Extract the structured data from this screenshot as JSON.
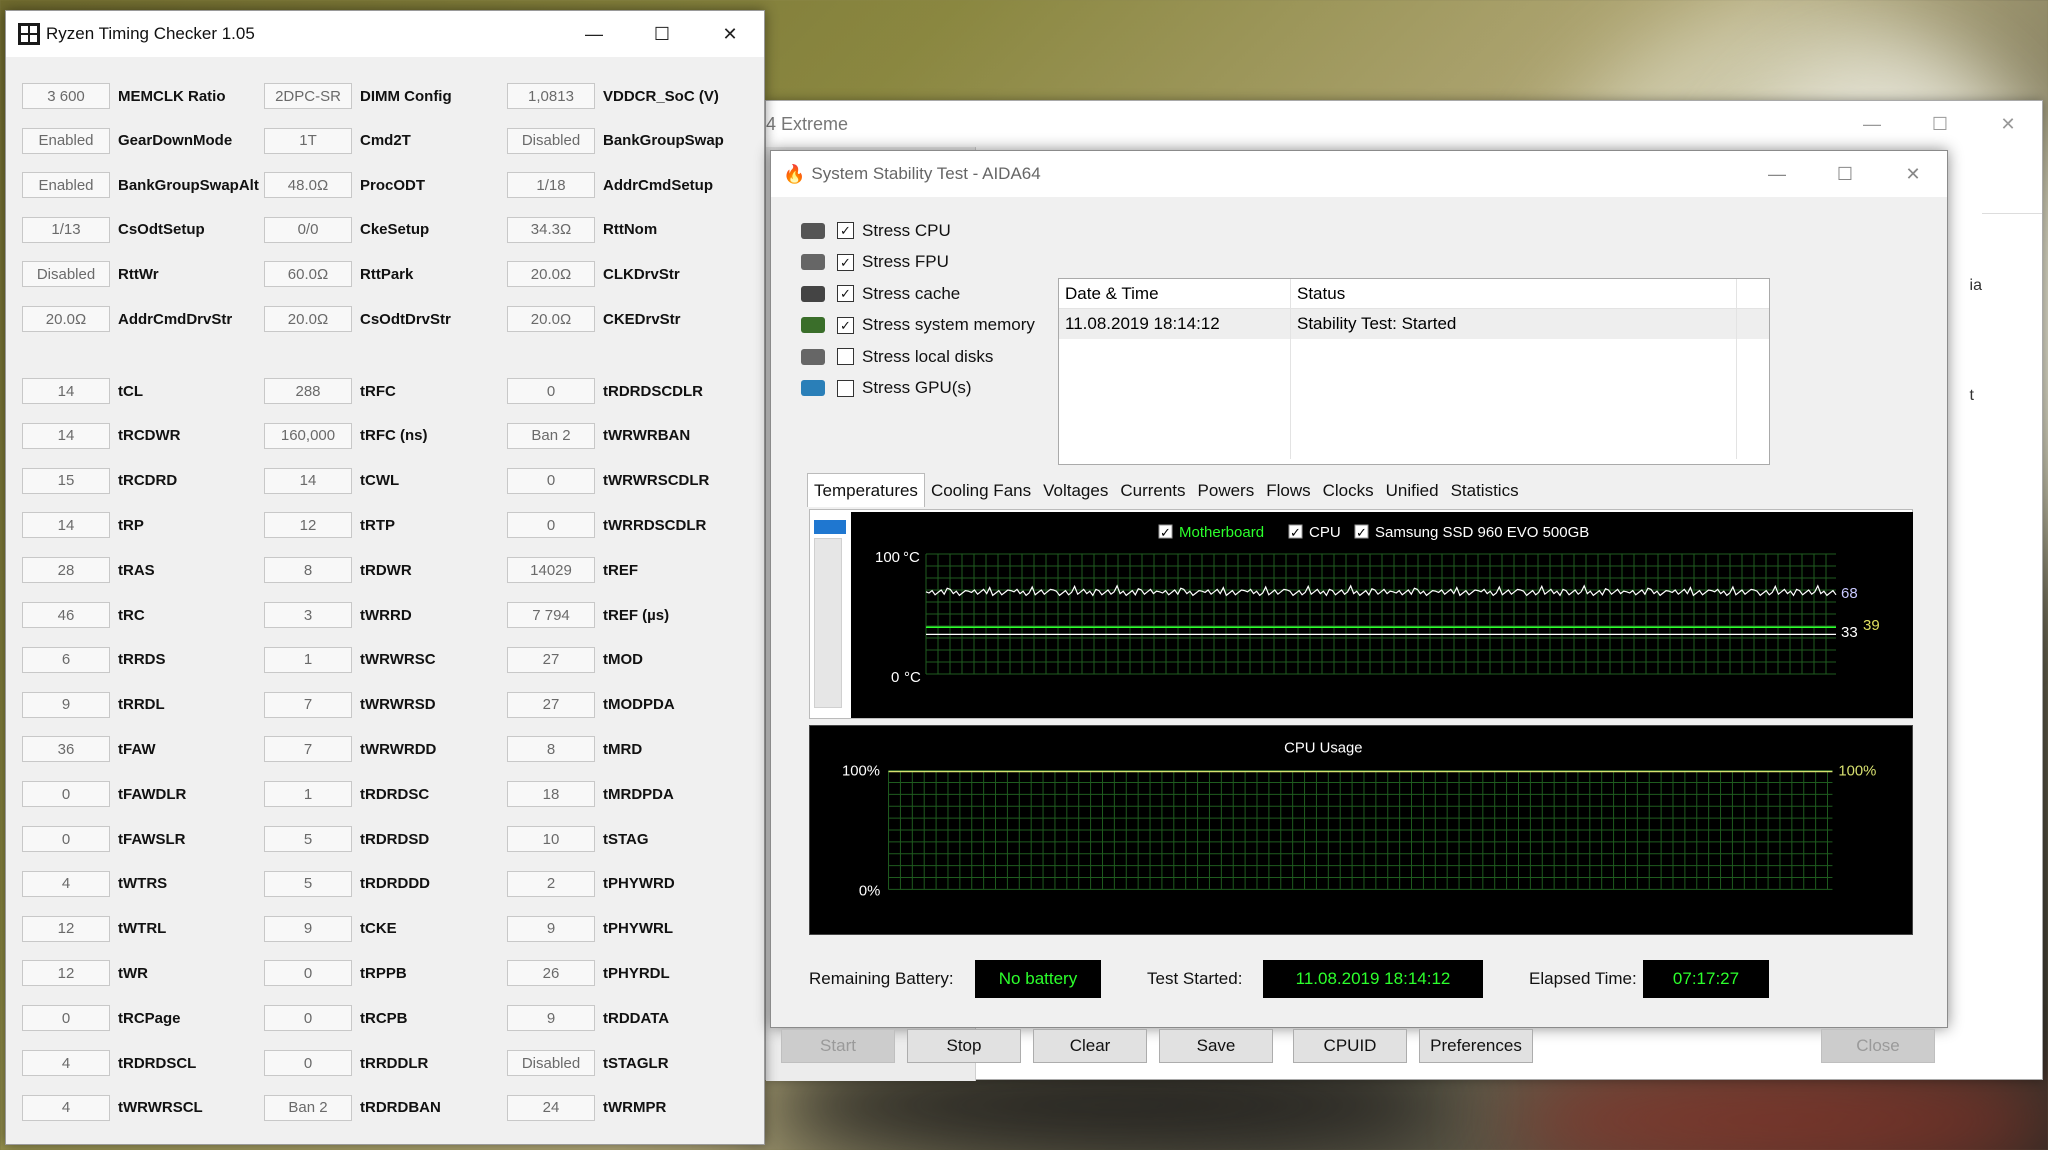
{
  "rtc": {
    "title": "Ryzen Timing Checker 1.05",
    "columns": [
      [
        {
          "val": "3 600",
          "label": "MEMCLK Ratio"
        },
        {
          "val": "Enabled",
          "label": "GearDownMode"
        },
        {
          "val": "Enabled",
          "label": "BankGroupSwapAlt"
        },
        {
          "val": "1/13",
          "label": "CsOdtSetup"
        },
        {
          "val": "Disabled",
          "label": "RttWr"
        },
        {
          "val": "20.0Ω",
          "label": "AddrCmdDrvStr"
        },
        {
          "val": "14",
          "label": "tCL"
        },
        {
          "val": "14",
          "label": "tRCDWR"
        },
        {
          "val": "15",
          "label": "tRCDRD"
        },
        {
          "val": "14",
          "label": "tRP"
        },
        {
          "val": "28",
          "label": "tRAS"
        },
        {
          "val": "46",
          "label": "tRC"
        },
        {
          "val": "6",
          "label": "tRRDS"
        },
        {
          "val": "9",
          "label": "tRRDL"
        },
        {
          "val": "36",
          "label": "tFAW"
        },
        {
          "val": "0",
          "label": "tFAWDLR"
        },
        {
          "val": "0",
          "label": "tFAWSLR"
        },
        {
          "val": "4",
          "label": "tWTRS"
        },
        {
          "val": "12",
          "label": "tWTRL"
        },
        {
          "val": "12",
          "label": "tWR"
        },
        {
          "val": "0",
          "label": "tRCPage"
        },
        {
          "val": "4",
          "label": "tRDRDSCL"
        },
        {
          "val": "4",
          "label": "tWRWRSCL"
        }
      ],
      [
        {
          "val": "2DPC-SR",
          "label": "DIMM Config"
        },
        {
          "val": "1T",
          "label": "Cmd2T"
        },
        {
          "val": "48.0Ω",
          "label": "ProcODT"
        },
        {
          "val": "0/0",
          "label": "CkeSetup"
        },
        {
          "val": "60.0Ω",
          "label": "RttPark"
        },
        {
          "val": "20.0Ω",
          "label": "CsOdtDrvStr"
        },
        {
          "val": "288",
          "label": "tRFC"
        },
        {
          "val": "160,000",
          "label": "tRFC (ns)"
        },
        {
          "val": "14",
          "label": "tCWL"
        },
        {
          "val": "12",
          "label": "tRTP"
        },
        {
          "val": "8",
          "label": "tRDWR"
        },
        {
          "val": "3",
          "label": "tWRRD"
        },
        {
          "val": "1",
          "label": "tWRWRSC"
        },
        {
          "val": "7",
          "label": "tWRWRSD"
        },
        {
          "val": "7",
          "label": "tWRWRDD"
        },
        {
          "val": "1",
          "label": "tRDRDSC"
        },
        {
          "val": "5",
          "label": "tRDRDSD"
        },
        {
          "val": "5",
          "label": "tRDRDDD"
        },
        {
          "val": "9",
          "label": "tCKE"
        },
        {
          "val": "0",
          "label": "tRPPB"
        },
        {
          "val": "0",
          "label": "tRCPB"
        },
        {
          "val": "0",
          "label": "tRRDDLR"
        },
        {
          "val": "Ban 2",
          "label": "tRDRDBAN"
        }
      ],
      [
        {
          "val": "1,0813",
          "label": "VDDCR_SoC (V)"
        },
        {
          "val": "Disabled",
          "label": "BankGroupSwap"
        },
        {
          "val": "1/18",
          "label": "AddrCmdSetup"
        },
        {
          "val": "34.3Ω",
          "label": "RttNom"
        },
        {
          "val": "20.0Ω",
          "label": "CLKDrvStr"
        },
        {
          "val": "20.0Ω",
          "label": "CKEDrvStr"
        },
        {
          "val": "0",
          "label": "tRDRDSCDLR"
        },
        {
          "val": "Ban 2",
          "label": "tWRWRBAN"
        },
        {
          "val": "0",
          "label": "tWRWRSCDLR"
        },
        {
          "val": "0",
          "label": "tWRRDSCDLR"
        },
        {
          "val": "14029",
          "label": "tREF"
        },
        {
          "val": "7 794",
          "label": "tREF (µs)"
        },
        {
          "val": "27",
          "label": "tMOD"
        },
        {
          "val": "27",
          "label": "tMODPDA"
        },
        {
          "val": "8",
          "label": "tMRD"
        },
        {
          "val": "18",
          "label": "tMRDPDA"
        },
        {
          "val": "10",
          "label": "tSTAG"
        },
        {
          "val": "2",
          "label": "tPHYWRD"
        },
        {
          "val": "9",
          "label": "tPHYWRL"
        },
        {
          "val": "26",
          "label": "tPHYRDL"
        },
        {
          "val": "9",
          "label": "tRDDATA"
        },
        {
          "val": "Disabled",
          "label": "tSTAGLR"
        },
        {
          "val": "24",
          "label": "tWRMPR"
        }
      ]
    ]
  },
  "aida_main": {
    "title": "4 Extreme",
    "fragments": [
      "ia",
      "t"
    ]
  },
  "sst": {
    "title": "System Stability Test - AIDA64",
    "stress_items": [
      {
        "label": "Stress CPU",
        "checked": true,
        "icon": "cpu-icon"
      },
      {
        "label": "Stress FPU",
        "checked": true,
        "icon": "fpu-icon"
      },
      {
        "label": "Stress cache",
        "checked": true,
        "icon": "cache-icon"
      },
      {
        "label": "Stress system memory",
        "checked": true,
        "icon": "memory-icon"
      },
      {
        "label": "Stress local disks",
        "checked": false,
        "icon": "disk-icon"
      },
      {
        "label": "Stress GPU(s)",
        "checked": false,
        "icon": "gpu-icon"
      }
    ],
    "log": {
      "headers": [
        "Date & Time",
        "Status"
      ],
      "rows": [
        [
          "11.08.2019 18:14:12",
          "Stability Test: Started"
        ]
      ]
    },
    "tabs": [
      "Temperatures",
      "Cooling Fans",
      "Voltages",
      "Currents",
      "Powers",
      "Flows",
      "Clocks",
      "Unified",
      "Statistics"
    ],
    "temp_graph": {
      "legend": [
        {
          "label": "Motherboard",
          "color": "#2cff2c"
        },
        {
          "label": "CPU",
          "color": "#ffffff"
        },
        {
          "label": "Samsung SSD 960 EVO 500GB",
          "color": "#ffffff"
        }
      ],
      "y_top": "100",
      "y_bottom": "0",
      "unit": "°C",
      "readouts": [
        "68",
        "33",
        "39"
      ],
      "readout_colors": [
        "#c8c8ff",
        "#ffffff",
        "#e0e060"
      ]
    },
    "cpu_graph": {
      "title": "CPU Usage",
      "y_top": "100%",
      "y_bottom": "0%",
      "readout": "100%"
    },
    "status": {
      "battery_label": "Remaining Battery:",
      "battery_value": "No battery",
      "started_label": "Test Started:",
      "started_value": "11.08.2019 18:14:12",
      "elapsed_label": "Elapsed Time:",
      "elapsed_value": "07:17:27"
    },
    "buttons": {
      "start": "Start",
      "stop": "Stop",
      "clear": "Clear",
      "save": "Save",
      "cpuid": "CPUID",
      "preferences": "Preferences",
      "close": "Close"
    }
  }
}
